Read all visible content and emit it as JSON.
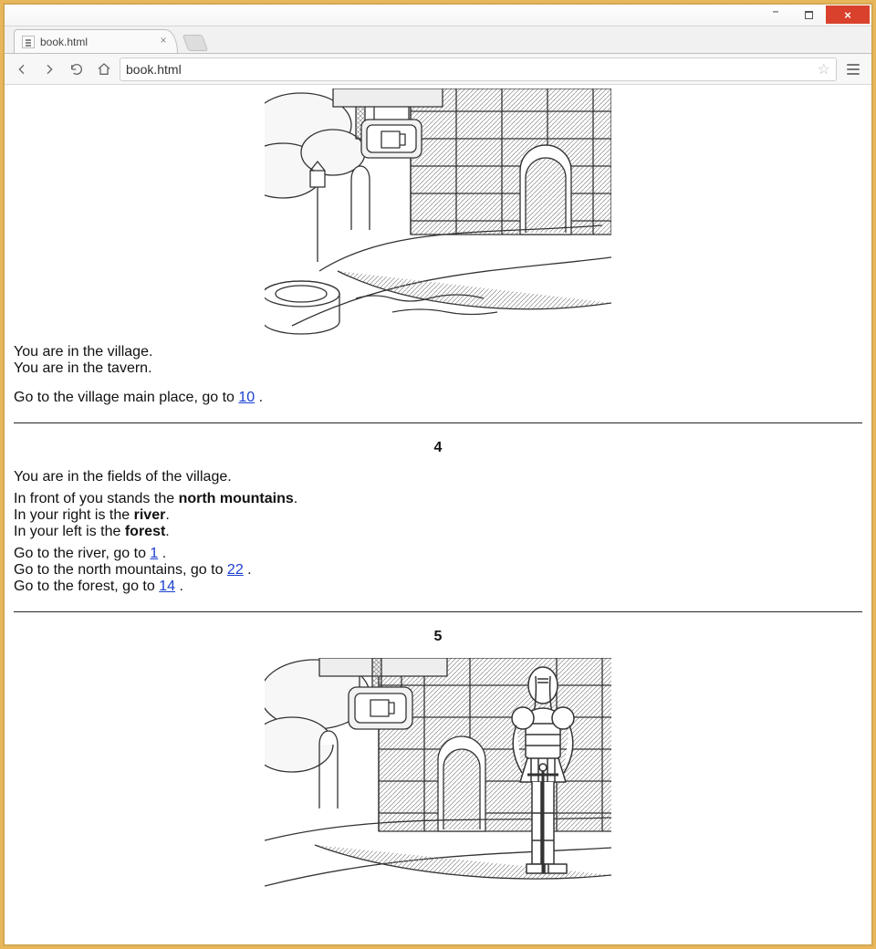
{
  "window": {
    "tab_title": "book.html",
    "url_text": "book.html",
    "minimize_label": "–",
    "close_label": "×"
  },
  "section3": {
    "line1": "You are in the village.",
    "line2": "You are in the tavern.",
    "go_prefix": "Go to the village main place, go to ",
    "go_link": "10",
    "go_suffix": " ."
  },
  "section4": {
    "heading": "4",
    "intro": "You are in the fields of the village.",
    "ln1_before": "In front of you stands the ",
    "ln1_bold": "north mountains",
    "ln1_after": ".",
    "ln2_before": "In your right is the ",
    "ln2_bold": "river",
    "ln2_after": ".",
    "ln3_before": "In your left is the ",
    "ln3_bold": "forest",
    "ln3_after": ".",
    "g1_before": "Go to the river, go to ",
    "g1_link": "1",
    "g1_after": " .",
    "g2_before": "Go to the north mountains, go to ",
    "g2_link": "22",
    "g2_after": " .",
    "g3_before": "Go to the forest, go to ",
    "g3_link": "14",
    "g3_after": " ."
  },
  "section5": {
    "heading": "5"
  }
}
